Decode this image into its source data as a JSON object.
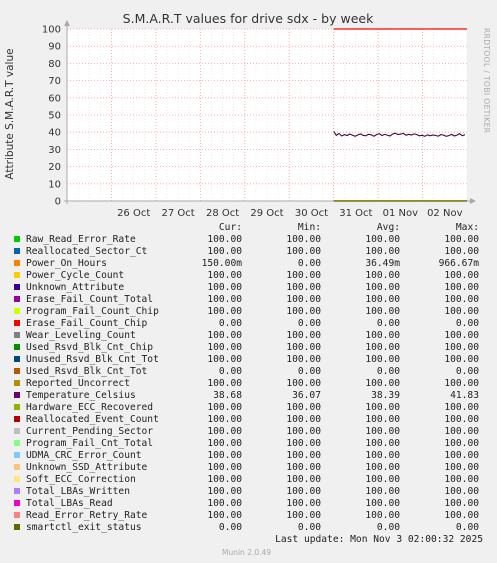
{
  "chart_data": {
    "type": "line",
    "title": "S.M.A.R.T values for drive sdx - by week",
    "ylabel": "Attribute S.M.A.R.T value",
    "ylim": [
      0,
      100
    ],
    "yticks": [
      "0",
      "10",
      "20",
      "30",
      "40",
      "50",
      "60",
      "70",
      "80",
      "90",
      "100"
    ],
    "xlim": [
      "2025-10-25",
      "2025-11-03"
    ],
    "xticks": [
      {
        "label": "26 Oct",
        "date": "2025-10-26"
      },
      {
        "label": "27 Oct",
        "date": "2025-10-27"
      },
      {
        "label": "28 Oct",
        "date": "2025-10-28"
      },
      {
        "label": "29 Oct",
        "date": "2025-10-29"
      },
      {
        "label": "30 Oct",
        "date": "2025-10-30"
      },
      {
        "label": "31 Oct",
        "date": "2025-10-31"
      },
      {
        "label": "01 Nov",
        "date": "2025-11-01"
      },
      {
        "label": "02 Nov",
        "date": "2025-11-02"
      }
    ],
    "data_start": "2025-10-31",
    "grid": true,
    "series": [
      {
        "name": "Reallocated_Sector_Ct",
        "color": "#ff0000",
        "value": 100
      },
      {
        "name": "Temperature_Celsius",
        "color": "#4b0048",
        "values": [
          40.5,
          38.2,
          39.3,
          37.8,
          38.6,
          38.1,
          38.9,
          38.3,
          37.6,
          38.4,
          39.0,
          38.2,
          37.9,
          38.8,
          38.5,
          37.7,
          38.6,
          39.2,
          38.1,
          38.7,
          38.3,
          37.8,
          38.9,
          39.4,
          38.6,
          38.9,
          39.3,
          38.2,
          38.8,
          38.4,
          39.0,
          38.6,
          37.9,
          38.2,
          37.6,
          38.5,
          37.9,
          38.4,
          38.1,
          37.7,
          38.6,
          38.3,
          37.6,
          38.0,
          38.7,
          37.8,
          38.3,
          39.1,
          37.9,
          38.6
        ]
      },
      {
        "name": "Power_On_Hours",
        "color": "#ffa500",
        "value": 0.15
      },
      {
        "name": "Used_Rsvd_Blk_Cnt_Tot",
        "color": "#556b00",
        "value": 0
      }
    ]
  },
  "side_text": "RRDTOOL / TOBI OETIKER",
  "legend": {
    "headers": [
      "Cur:",
      "Min:",
      "Avg:",
      "Max:"
    ],
    "rows": [
      {
        "name": "Raw_Read_Error_Rate",
        "color": "#00cc00",
        "cur": "100.00",
        "min": "100.00",
        "avg": "100.00",
        "max": "100.00"
      },
      {
        "name": "Reallocated_Sector_Ct",
        "color": "#0066b3",
        "cur": "100.00",
        "min": "100.00",
        "avg": "100.00",
        "max": "100.00"
      },
      {
        "name": "Power_On_Hours",
        "color": "#ff8000",
        "cur": "150.00m",
        "min": "0.00",
        "avg": "36.49m",
        "max": "966.67m"
      },
      {
        "name": "Power_Cycle_Count",
        "color": "#ffcc00",
        "cur": "100.00",
        "min": "100.00",
        "avg": "100.00",
        "max": "100.00"
      },
      {
        "name": "Unknown_Attribute",
        "color": "#330099",
        "cur": "100.00",
        "min": "100.00",
        "avg": "100.00",
        "max": "100.00"
      },
      {
        "name": "Erase_Fail_Count_Total",
        "color": "#990099",
        "cur": "100.00",
        "min": "100.00",
        "avg": "100.00",
        "max": "100.00"
      },
      {
        "name": "Program_Fail_Count_Chip",
        "color": "#ccff00",
        "cur": "100.00",
        "min": "100.00",
        "avg": "100.00",
        "max": "100.00"
      },
      {
        "name": "Erase_Fail_Count_Chip",
        "color": "#ff0000",
        "cur": "0.00",
        "min": "0.00",
        "avg": "0.00",
        "max": "0.00"
      },
      {
        "name": "Wear_Leveling_Count",
        "color": "#808080",
        "cur": "100.00",
        "min": "100.00",
        "avg": "100.00",
        "max": "100.00"
      },
      {
        "name": "Used_Rsvd_Blk_Cnt_Chip",
        "color": "#008f00",
        "cur": "100.00",
        "min": "100.00",
        "avg": "100.00",
        "max": "100.00"
      },
      {
        "name": "Unused_Rsvd_Blk_Cnt_Tot",
        "color": "#00487d",
        "cur": "100.00",
        "min": "100.00",
        "avg": "100.00",
        "max": "100.00"
      },
      {
        "name": "Used_Rsvd_Blk_Cnt_Tot",
        "color": "#b35a00",
        "cur": "0.00",
        "min": "0.00",
        "avg": "0.00",
        "max": "0.00"
      },
      {
        "name": "Reported_Uncorrect",
        "color": "#b38f00",
        "cur": "100.00",
        "min": "100.00",
        "avg": "100.00",
        "max": "100.00"
      },
      {
        "name": "Temperature_Celsius",
        "color": "#6b006b",
        "cur": "38.68",
        "min": "36.07",
        "avg": "38.39",
        "max": "41.83"
      },
      {
        "name": "Hardware_ECC_Recovered",
        "color": "#8fb300",
        "cur": "100.00",
        "min": "100.00",
        "avg": "100.00",
        "max": "100.00"
      },
      {
        "name": "Reallocated_Event_Count",
        "color": "#b30000",
        "cur": "100.00",
        "min": "100.00",
        "avg": "100.00",
        "max": "100.00"
      },
      {
        "name": "Current_Pending_Sector",
        "color": "#bebebe",
        "cur": "100.00",
        "min": "100.00",
        "avg": "100.00",
        "max": "100.00"
      },
      {
        "name": "Program_Fail_Cnt_Total",
        "color": "#80ff80",
        "cur": "100.00",
        "min": "100.00",
        "avg": "100.00",
        "max": "100.00"
      },
      {
        "name": "UDMA_CRC_Error_Count",
        "color": "#80c9ff",
        "cur": "100.00",
        "min": "100.00",
        "avg": "100.00",
        "max": "100.00"
      },
      {
        "name": "Unknown_SSD_Attribute",
        "color": "#ffc080",
        "cur": "100.00",
        "min": "100.00",
        "avg": "100.00",
        "max": "100.00"
      },
      {
        "name": "Soft_ECC_Correction",
        "color": "#ffe680",
        "cur": "100.00",
        "min": "100.00",
        "avg": "100.00",
        "max": "100.00"
      },
      {
        "name": "Total_LBAs_Written",
        "color": "#aa80ff",
        "cur": "100.00",
        "min": "100.00",
        "avg": "100.00",
        "max": "100.00"
      },
      {
        "name": "Total_LBAs_Read",
        "color": "#ee00cc",
        "cur": "100.00",
        "min": "100.00",
        "avg": "100.00",
        "max": "100.00"
      },
      {
        "name": "Read_Error_Retry_Rate",
        "color": "#ff8080",
        "cur": "100.00",
        "min": "100.00",
        "avg": "100.00",
        "max": "100.00"
      },
      {
        "name": "smartctl_exit_status",
        "color": "#666600",
        "cur": "0.00",
        "min": "0.00",
        "avg": "0.00",
        "max": "0.00"
      }
    ]
  },
  "last_update": "Last update: Mon Nov  3 02:00:32 2025",
  "munin_version": "Munin 2.0.49"
}
